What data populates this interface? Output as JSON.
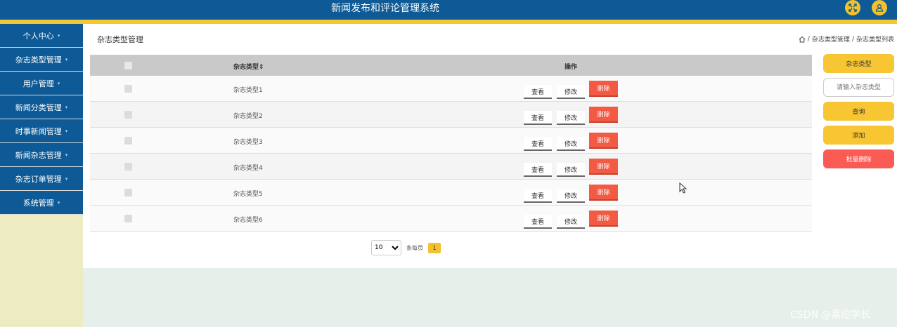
{
  "header": {
    "title": "新闻发布和评论管理系统",
    "fullscreen_icon": "expand-icon",
    "user_icon": "user-icon",
    "accent_color": "#0d5a96",
    "stripe_color": "#f3c633"
  },
  "sidebar": {
    "items": [
      {
        "label": "个人中心"
      },
      {
        "label": "杂志类型管理"
      },
      {
        "label": "用户管理"
      },
      {
        "label": "新闻分类管理"
      },
      {
        "label": "时事新闻管理"
      },
      {
        "label": "新闻杂志管理"
      },
      {
        "label": "杂志订单管理"
      },
      {
        "label": "系统管理"
      }
    ]
  },
  "main": {
    "page_title": "杂志类型管理",
    "breadcrumb": {
      "home_icon": "home-icon",
      "items": [
        "杂志类型管理",
        "杂志类型列表"
      ],
      "separator": "/"
    },
    "table": {
      "headers": {
        "name": "杂志类型",
        "sort_icon": "sort-icon",
        "ops": "操作"
      },
      "rows": [
        {
          "name": "杂志类型1"
        },
        {
          "name": "杂志类型2"
        },
        {
          "name": "杂志类型3"
        },
        {
          "name": "杂志类型4"
        },
        {
          "name": "杂志类型5"
        },
        {
          "name": "杂志类型6"
        }
      ],
      "view_label": "查看",
      "edit_label": "修改",
      "delete_label": "删除"
    },
    "pagination": {
      "page_size": "10",
      "page_size_options": [
        "10"
      ],
      "per_page_label": "条每页",
      "current_page": "1"
    }
  },
  "side_panel": {
    "type_label": "杂志类型",
    "search_placeholder": "请输入杂志类型",
    "query_label": "查询",
    "add_label": "添加",
    "batch_delete_label": "批量删除"
  },
  "watermark": "CSDN @嘉应学长"
}
